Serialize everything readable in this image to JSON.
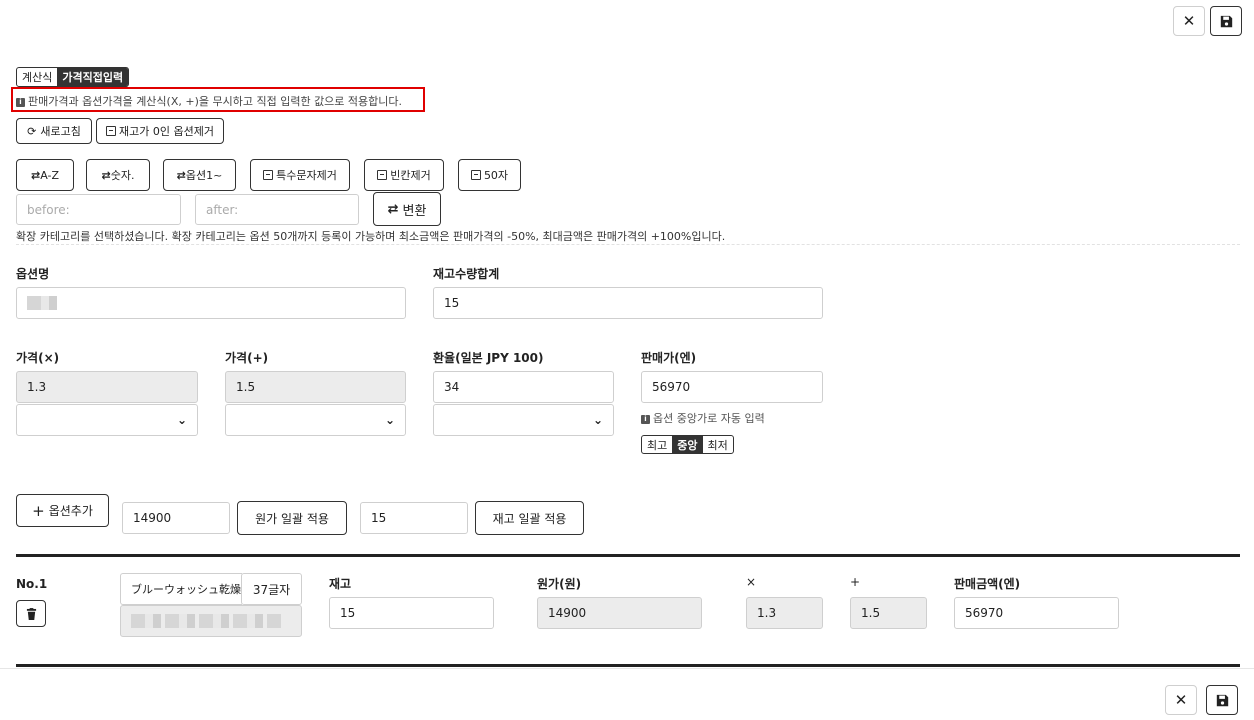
{
  "toolbar": {
    "close_icon": "close-icon",
    "save_icon": "save-icon"
  },
  "mode_tabs": {
    "tab1": "계산식",
    "tab2": "가격직접입력",
    "active": "가격직접입력"
  },
  "notice": "판매가격과 옵션가격을 계산식(X, +)을 무시하고 직접 입력한 값으로 적용합니다.",
  "actions": {
    "refresh": "새로고침",
    "remove_zero": "재고가 0인 옵션제거"
  },
  "sort_buttons": {
    "az": "A-Z",
    "num": "숫자.",
    "opt": "옵션1~",
    "special": "특수문자제거",
    "blank": "빈칸제거",
    "fifty": "50자"
  },
  "replace": {
    "before_placeholder": "before:",
    "after_placeholder": "after:",
    "convert": "변환"
  },
  "category_notice": "확장 카테고리를 선택하셨습니다. 확장 카테고리는 옵션 50개까지 등록이 가능하며 최소금액은 판매가격의 -50%, 최대금액은 판매가격의 +100%입니다.",
  "fields": {
    "option_name_label": "옵션명",
    "stock_total_label": "재고수량합계",
    "stock_total_value": "15",
    "price_x_label": "가격(×)",
    "price_x_value": "1.3",
    "price_plus_label": "가격(+)",
    "price_plus_value": "1.5",
    "rate_label": "환율(일본 JPY 100)",
    "rate_value": "34",
    "sale_price_label": "판매가(엔)",
    "sale_price_value": "56970",
    "auto_note": "옵션 중앙가로 자동 입력",
    "price_mode": [
      "최고",
      "중앙",
      "최저"
    ],
    "price_mode_active": "중앙"
  },
  "bulk": {
    "add_option": "옵션추가",
    "cost_value": "14900",
    "cost_apply": "원가 일괄 적용",
    "stock_value": "15",
    "stock_apply": "재고 일괄 적용"
  },
  "option_rows": [
    {
      "no": "No.1",
      "name": "ブルーウォッシュ乾燥",
      "char_count": "37글자",
      "stock_label": "재고",
      "stock": "15",
      "cost_label": "원가(원)",
      "cost": "14900",
      "x_label": "×",
      "x": "1.3",
      "plus_label": "+",
      "plus": "1.5",
      "sale_label": "판매금액(엔)",
      "sale": "56970"
    }
  ]
}
